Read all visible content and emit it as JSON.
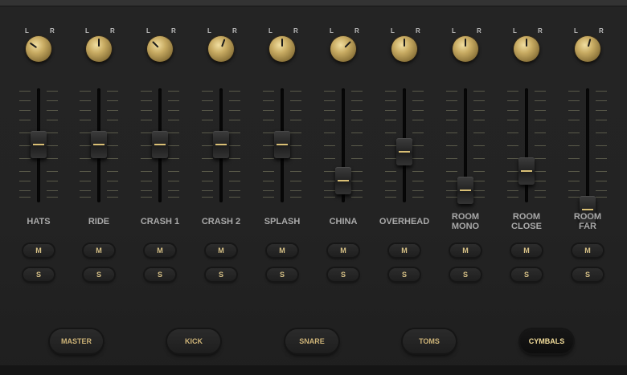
{
  "knob_labels": {
    "left": "L",
    "right": "R"
  },
  "channels": [
    {
      "name": "HATS",
      "mute": "M",
      "solo": "S",
      "pan_deg": -55,
      "fader_level": 0.79
    },
    {
      "name": "RIDE",
      "mute": "M",
      "solo": "S",
      "pan_deg": 0,
      "fader_level": 0.79
    },
    {
      "name": "CRASH 1",
      "mute": "M",
      "solo": "S",
      "pan_deg": -45,
      "fader_level": 0.79
    },
    {
      "name": "CRASH 2",
      "mute": "M",
      "solo": "S",
      "pan_deg": 20,
      "fader_level": 0.79
    },
    {
      "name": "SPLASH",
      "mute": "M",
      "solo": "S",
      "pan_deg": 0,
      "fader_level": 0.79
    },
    {
      "name": "CHINA",
      "mute": "M",
      "solo": "S",
      "pan_deg": 45,
      "fader_level": 0.37
    },
    {
      "name": "OVERHEAD",
      "mute": "M",
      "solo": "S",
      "pan_deg": 0,
      "fader_level": 0.7
    },
    {
      "name": "ROOM\nMONO",
      "mute": "M",
      "solo": "S",
      "pan_deg": 0,
      "fader_level": 0.26
    },
    {
      "name": "ROOM\nCLOSE",
      "mute": "M",
      "solo": "S",
      "pan_deg": 0,
      "fader_level": 0.48
    },
    {
      "name": "ROOM\nFAR",
      "mute": "M",
      "solo": "S",
      "pan_deg": 15,
      "fader_level": 0.04
    }
  ],
  "buses": [
    {
      "label": "MASTER",
      "active": false
    },
    {
      "label": "KICK",
      "active": false
    },
    {
      "label": "SNARE",
      "active": false
    },
    {
      "label": "TOMS",
      "active": false
    },
    {
      "label": "CYMBALS",
      "active": true
    }
  ],
  "colors": {
    "accent": "#d9bf75",
    "background": "#232323"
  }
}
